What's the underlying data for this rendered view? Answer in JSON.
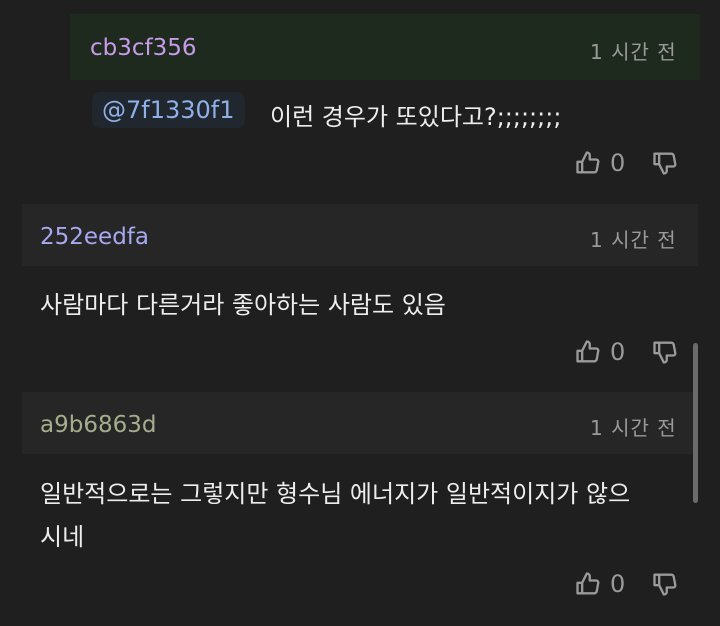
{
  "comments": [
    {
      "username": "cb3cf356",
      "time": "1 시간 전",
      "mention": "@7f1330f1",
      "text": "이런 경우가 또있다고?;;;;;;;;",
      "likes": "0",
      "username_color": "#c79be8"
    },
    {
      "username": "252eedfa",
      "time": "1 시간 전",
      "text": "사람마다 다른거라 좋아하는 사람도 있음",
      "likes": "0",
      "username_color": "#a7a8f0"
    },
    {
      "username": "a9b6863d",
      "time": "1 시간 전",
      "text_line1": "일반적으로는 그렇지만 형수님 에너지가 일반적이지가 않으",
      "text_line2": "시네",
      "likes": "0",
      "username_color": "#a6ad8c"
    }
  ],
  "icons": [
    "thumbs-up-icon",
    "thumbs-down-icon"
  ]
}
